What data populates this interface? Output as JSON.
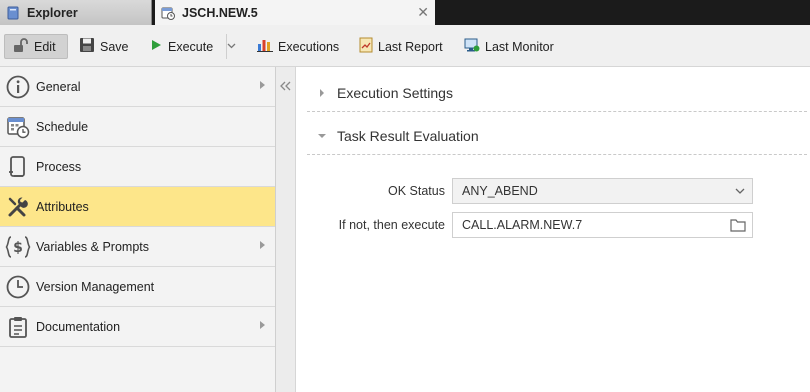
{
  "tabs": [
    {
      "label": "Explorer",
      "icon": "explorer-icon"
    },
    {
      "label": "JSCH.NEW.5",
      "icon": "schedule-object-icon",
      "active": true
    }
  ],
  "toolbar": {
    "edit": "Edit",
    "save": "Save",
    "execute": "Execute",
    "executions": "Executions",
    "last_report": "Last Report",
    "last_monitor": "Last Monitor"
  },
  "sidebar": {
    "items": [
      {
        "label": "General",
        "icon": "info-icon",
        "has_submenu": true
      },
      {
        "label": "Schedule",
        "icon": "calendar-clock-icon",
        "has_submenu": false
      },
      {
        "label": "Process",
        "icon": "process-icon",
        "has_submenu": false
      },
      {
        "label": "Attributes",
        "icon": "wrench-screwdriver-icon",
        "has_submenu": false,
        "active": true
      },
      {
        "label": "Variables & Prompts",
        "icon": "variables-icon",
        "has_submenu": true
      },
      {
        "label": "Version Management",
        "icon": "clock-icon",
        "has_submenu": false
      },
      {
        "label": "Documentation",
        "icon": "clipboard-icon",
        "has_submenu": true
      }
    ]
  },
  "main": {
    "sections": [
      {
        "title": "Execution Settings",
        "expanded": false
      },
      {
        "title": "Task Result Evaluation",
        "expanded": true
      }
    ],
    "fields": {
      "ok_status": {
        "label": "OK Status",
        "value": "ANY_ABEND"
      },
      "if_not_execute": {
        "label": "If not, then execute",
        "value": "CALL.ALARM.NEW.7"
      }
    }
  },
  "colors": {
    "active_nav": "#fde68a",
    "tabbar_bg": "#1b1b1b",
    "execute_green": "#2e9e3a"
  }
}
